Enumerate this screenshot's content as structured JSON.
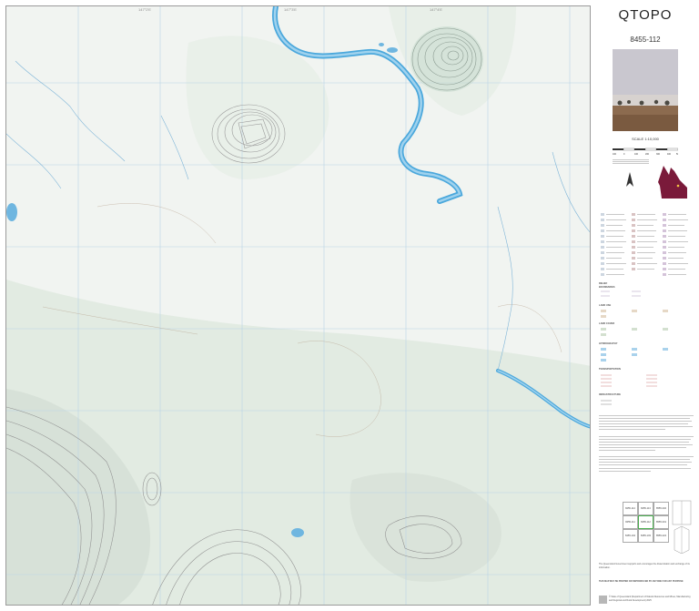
{
  "map": {
    "title": "QTOPO",
    "sheet_number": "8455-112",
    "scale_label": "SCALE 1:10,000",
    "scale_bar_ticks": [
      "100",
      "0",
      "100",
      "200",
      "300",
      "400",
      "500"
    ],
    "colors": {
      "background": "#f1f4f1",
      "vegetation": "#dfe9df",
      "water": "#4ba8dc",
      "contour": "#9a9a9a",
      "grid": "#b9d3e6",
      "locator_state": "#7a1a3a"
    },
    "adjoining_sheets": [
      [
        "8455-114",
        "8455-113",
        "8555-332"
      ],
      [
        "8455-111",
        "8455-112",
        "8555-331"
      ],
      [
        "8455-104",
        "8455-103",
        "8555-224"
      ]
    ],
    "legend_sections": [
      "RELIEF",
      "BOUNDARIES",
      "LAND USE",
      "LAND COVER",
      "HYDROGRAPHY",
      "TRANSPORTATION",
      "INFRASTRUCTURE"
    ],
    "footer_lines": [
      "The Queensland Government supports and encourages the dissemination and exchange of its information.",
      "THIS MAP MAY BE PRINTED OR REPRODUCED BY ANYONE FOR ANY PURPOSE"
    ],
    "copyright": "© State of Queensland (Department of Natural Resources and Mines, Manufacturing and Regional and Rural Development) 2025"
  }
}
